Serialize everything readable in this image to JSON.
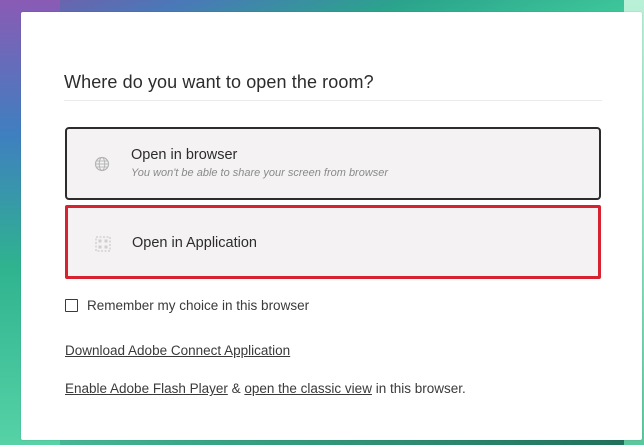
{
  "dialog": {
    "title": "Where do you want to open the room?",
    "options": [
      {
        "label": "Open in browser",
        "subtitle": "You won't be able to share your screen from browser",
        "icon": "globe-icon"
      },
      {
        "label": "Open in Application",
        "icon": "application-icon"
      }
    ],
    "remember": {
      "label": "Remember my choice in this browser",
      "checked": false
    },
    "download_link": "Download Adobe Connect Application",
    "flash": {
      "link1": "Enable Adobe Flash Player",
      "amp": " & ",
      "link2": "open the classic view",
      "suffix": " in this browser."
    }
  },
  "colors": {
    "highlight": "#d7232f",
    "selected_border": "#2c2c2c"
  }
}
